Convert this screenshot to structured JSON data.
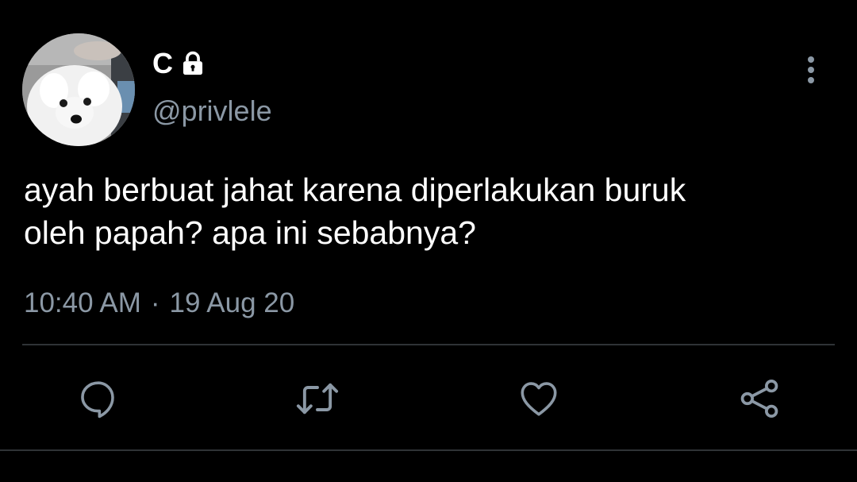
{
  "tweet": {
    "author": {
      "display_name": "C",
      "handle": "@privlele",
      "protected": true,
      "avatar": "white-dog-photo"
    },
    "text_line1": "ayah berbuat jahat karena diperlakukan buruk",
    "text_line2": "oleh papah? apa ini sebabnya?",
    "time": "10:40 AM",
    "separator": "·",
    "date": "19 Aug 20"
  },
  "actions": [
    {
      "icon": "reply-icon"
    },
    {
      "icon": "retweet-icon"
    },
    {
      "icon": "like-icon"
    },
    {
      "icon": "share-icon"
    }
  ],
  "colors": {
    "background": "#000000",
    "primary_text": "#ffffff",
    "secondary_text": "#8b98a5",
    "divider": "#2f3336"
  }
}
